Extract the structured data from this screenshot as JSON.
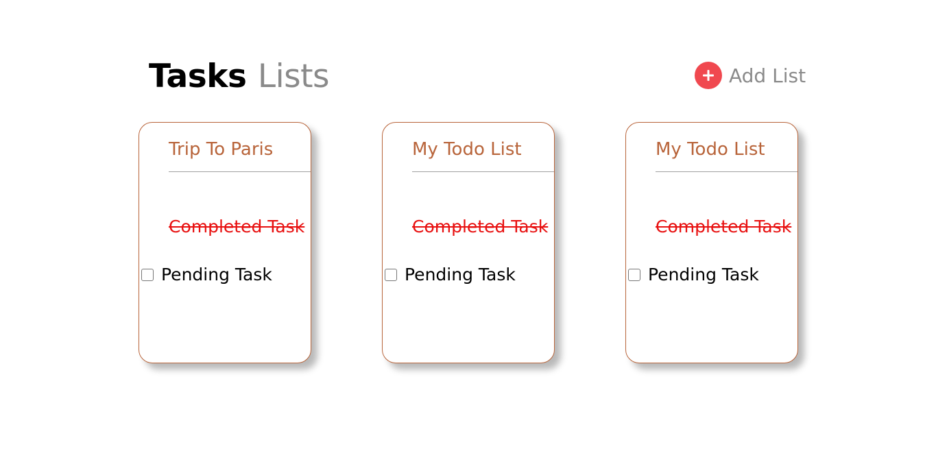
{
  "colors": {
    "accent": "#f0484f",
    "card_border": "#b8643a",
    "list_title": "#b8643a",
    "completed_task": "#e81010",
    "muted_text": "#8a8a8a"
  },
  "header": {
    "title_bold": "Tasks",
    "title_light": "Lists",
    "add_icon": "plus-icon",
    "add_label": "Add List"
  },
  "lists": [
    {
      "title": "Trip To Paris",
      "completed_task": "Completed Task",
      "pending_task": "Pending Task",
      "pending_checked": false
    },
    {
      "title": "My Todo List",
      "completed_task": "Completed Task",
      "pending_task": "Pending Task",
      "pending_checked": false
    },
    {
      "title": "My Todo List",
      "completed_task": "Completed Task",
      "pending_task": "Pending Task",
      "pending_checked": false
    }
  ]
}
